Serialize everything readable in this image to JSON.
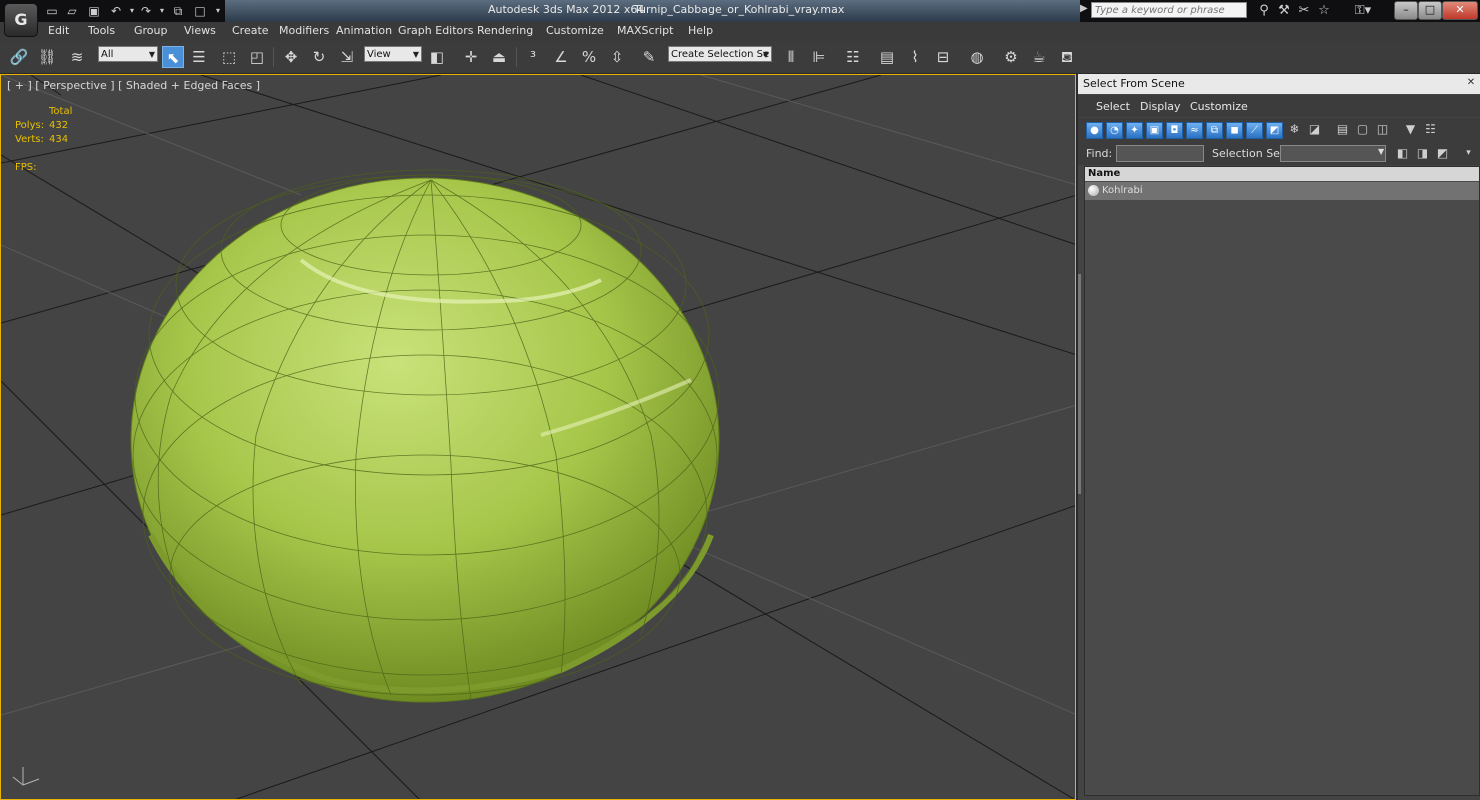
{
  "titlebar": {
    "app_title": "Autodesk 3ds Max  2012 x64",
    "file_name": "Turnip_Cabbage_or_Kohlrabi_vray.max",
    "search_placeholder": "Type a keyword or phrase"
  },
  "menubar": {
    "items": [
      "Edit",
      "Tools",
      "Group",
      "Views",
      "Create",
      "Modifiers",
      "Animation",
      "Graph Editors",
      "Rendering",
      "Customize",
      "MAXScript",
      "Help"
    ]
  },
  "toolbar": {
    "selection_filter": "All",
    "reference_coord": "View",
    "named_selection": "Create Selection Se"
  },
  "viewport": {
    "label": "[ + ] [ Perspective ] [ Shaded + Edged Faces ]",
    "stats_header": "Total",
    "polys_label": "Polys:",
    "polys_value": "432",
    "verts_label": "Verts:",
    "verts_value": "434",
    "fps_label": "FPS:",
    "highlight_color": "#e8b200",
    "mesh_color": "#a8c84a"
  },
  "panel": {
    "title": "Select From Scene",
    "menu": [
      "Select",
      "Display",
      "Customize"
    ],
    "find_label": "Find:",
    "selection_set_label": "Selection Set:",
    "list_header": "Name",
    "objects": [
      "Kohlrabi"
    ]
  }
}
